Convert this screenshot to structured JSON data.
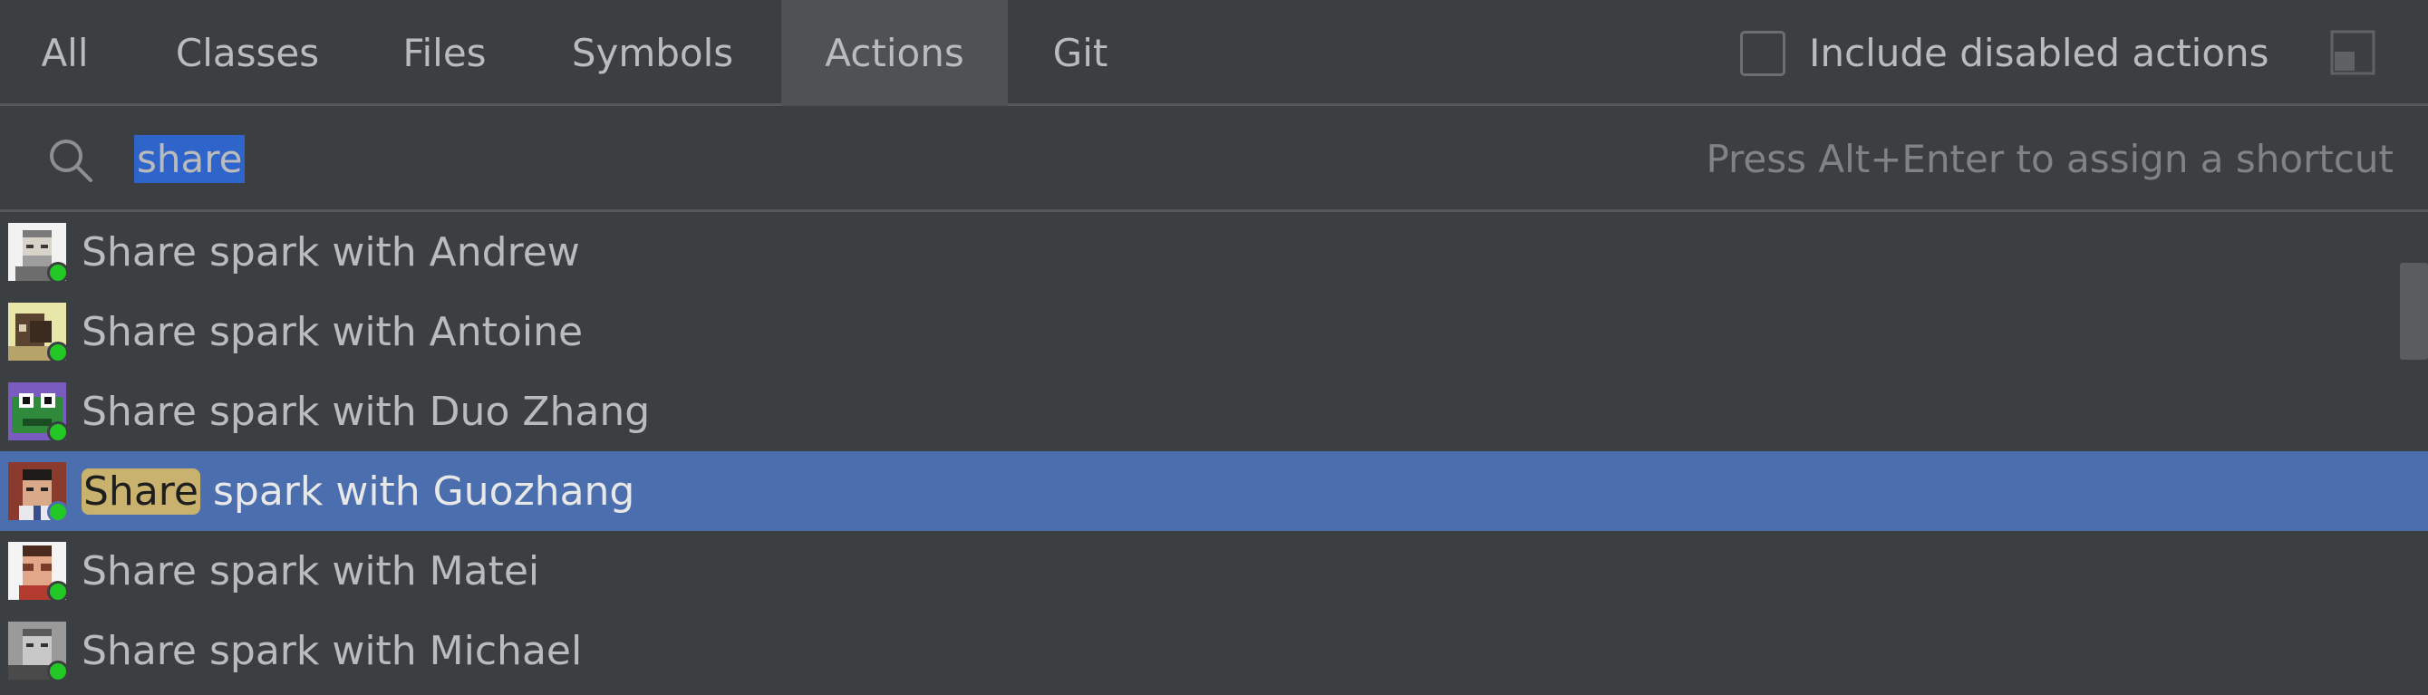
{
  "tabs": [
    {
      "label": "All",
      "active": false
    },
    {
      "label": "Classes",
      "active": false
    },
    {
      "label": "Files",
      "active": false
    },
    {
      "label": "Symbols",
      "active": false
    },
    {
      "label": "Actions",
      "active": true
    },
    {
      "label": "Git",
      "active": false
    }
  ],
  "include_disabled": {
    "label": "Include disabled actions",
    "checked": false
  },
  "search": {
    "query": "share",
    "hint": "Press Alt+Enter to assign a shortcut"
  },
  "results": [
    {
      "match": "Share",
      "rest": " spark with Andrew",
      "avatar": "avatar-andrew",
      "online": true,
      "selected": false
    },
    {
      "match": "Share",
      "rest": " spark with Antoine",
      "avatar": "avatar-antoine",
      "online": true,
      "selected": false
    },
    {
      "match": "Share",
      "rest": " spark with Duo Zhang",
      "avatar": "avatar-duo-zhang",
      "online": true,
      "selected": false
    },
    {
      "match": "Share",
      "rest": " spark with Guozhang",
      "avatar": "avatar-guozhang",
      "online": true,
      "selected": true
    },
    {
      "match": "Share",
      "rest": " spark with Matei",
      "avatar": "avatar-matei",
      "online": true,
      "selected": false
    },
    {
      "match": "Share",
      "rest": " spark with Michael",
      "avatar": "avatar-michael",
      "online": true,
      "selected": false
    }
  ],
  "colors": {
    "background": "#3c3f41",
    "active_tab": "#4e5254",
    "selection": "#4b6eaf",
    "match_highlight": "#c9b26d",
    "text_selection": "#2f65ca",
    "online": "#23c827"
  }
}
